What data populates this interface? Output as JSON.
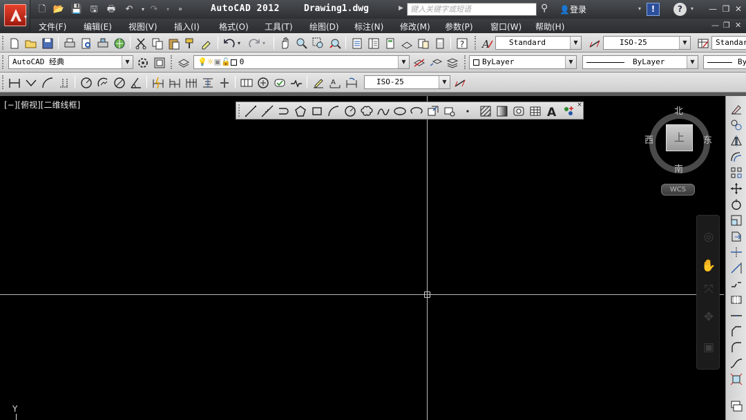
{
  "title_bar": {
    "app_title": "AutoCAD 2012",
    "document": "Drawing1.dwg",
    "search_placeholder": "键入关键字或短语",
    "login": "登录"
  },
  "menus": [
    "文件(F)",
    "编辑(E)",
    "视图(V)",
    "插入(I)",
    "格式(O)",
    "工具(T)",
    "绘图(D)",
    "标注(N)",
    "修改(M)",
    "参数(P)",
    "窗口(W)",
    "帮助(H)"
  ],
  "toolbar1": {
    "text_style": "Standard",
    "dim_style": "ISO-25",
    "table_style": "Standard"
  },
  "toolbar2": {
    "workspace": "AutoCAD 经典",
    "layer": "0",
    "color": "ByLayer",
    "linetype": "ByLayer",
    "lineweight": "ByLayer"
  },
  "toolbar3": {
    "dim_style": "ISO-25"
  },
  "viewport": {
    "label": "[−][俯视][二维线框]"
  },
  "viewcube": {
    "north": "北",
    "south": "南",
    "east": "东",
    "west": "西",
    "top_face": "上",
    "wcs": "WCS"
  },
  "ucs": {
    "y_label": "Y"
  },
  "colors": {
    "canvas": "#000000",
    "title_bar": "#3a3c40",
    "toolbar": "#dcdcdc",
    "crosshair": "#bbbbbb"
  }
}
